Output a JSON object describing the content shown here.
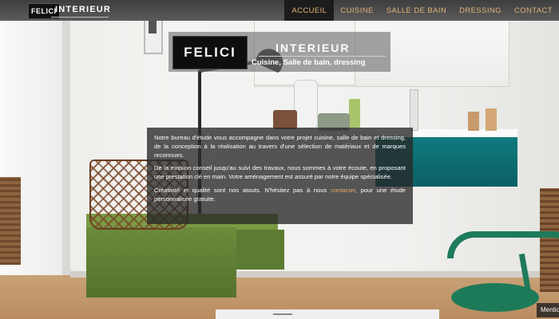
{
  "header": {
    "logo_mark": "FELICI",
    "logo_text": "INTERIEUR",
    "nav": [
      {
        "label": "ACCUEIL",
        "active": true
      },
      {
        "label": "CUISINE",
        "active": false
      },
      {
        "label": "SALLE DE BAIN",
        "active": false
      },
      {
        "label": "DRESSING",
        "active": false
      },
      {
        "label": "CONTACT",
        "active": false
      }
    ]
  },
  "hero": {
    "logo": "FELICI",
    "title": "INTERIEUR",
    "subtitle": "Cuisine, Salle de bain, dressing"
  },
  "intro": {
    "paragraph_1": "Notre bureau d'étude vous accompagne dans votre projet cuisine, salle de bain et dressing, de la conception à la réalisation au travers d'une sélection de matériaux et de marques reconnues.",
    "paragraph_2": "De la mission conseil jusqu'au suivi des travaux, nous sommes à votre écoute, en proposant une prestation clé en main. Votre aménagement est assuré par notre équipe spécialisée.",
    "paragraph_3_before": "Créativité et qualité sont nos atouts. N'hésitez pas à nous ",
    "paragraph_3_link": "contacter",
    "paragraph_3_after": ", pour une étude personnalisée gratuite."
  },
  "footer": {
    "mentions": "Mentions"
  },
  "colors": {
    "accent": "#e2b27a",
    "nav_active_bg": "#1c1c1c",
    "link": "#e2a85f"
  }
}
